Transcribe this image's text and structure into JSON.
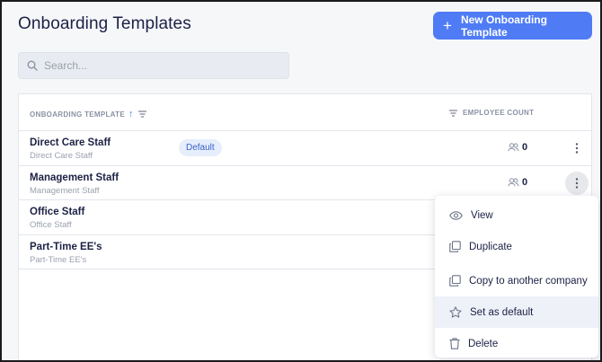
{
  "header": {
    "title": "Onboarding Templates",
    "new_button_label": "New Onboarding Template"
  },
  "search": {
    "placeholder": "Search..."
  },
  "table": {
    "columns": {
      "template": "ONBOARDING TEMPLATE",
      "count": "EMPLOYEE COUNT"
    },
    "rows": [
      {
        "name": "Direct Care Staff",
        "sub": "Direct Care Staff",
        "badge": "Default",
        "count": "0"
      },
      {
        "name": "Management Staff",
        "sub": "Management Staff",
        "count": "0"
      },
      {
        "name": "Office Staff",
        "sub": "Office Staff"
      },
      {
        "name": "Part-Time EE's",
        "sub": "Part-Time EE's"
      }
    ]
  },
  "menu": {
    "items": [
      {
        "label": "View",
        "icon": "eye-icon"
      },
      {
        "label": "Duplicate",
        "icon": "duplicate-icon"
      },
      {
        "label": "Copy to another company",
        "icon": "copy-icon"
      },
      {
        "label": "Set as default",
        "icon": "star-icon"
      },
      {
        "label": "Delete",
        "icon": "trash-icon"
      }
    ]
  },
  "colors": {
    "accent": "#4f7cf5",
    "badge_bg": "#e6eefc",
    "text": "#1c2145"
  }
}
